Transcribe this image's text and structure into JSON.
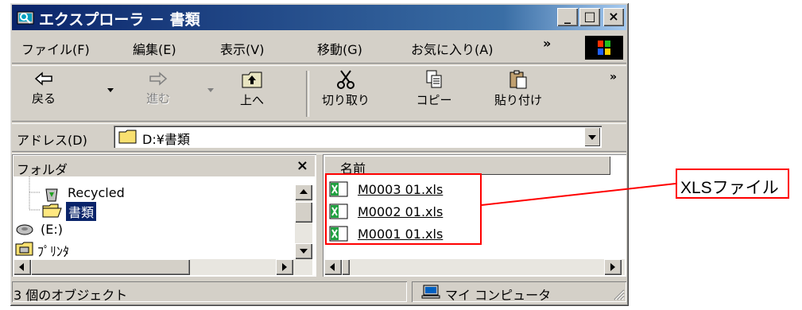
{
  "window": {
    "title": "エクスプローラ － 書類",
    "controls": [
      "_",
      "□",
      "×"
    ]
  },
  "menu": {
    "items": [
      "ファイル(F)",
      "編集(E)",
      "表示(V)",
      "移動(G)",
      "お気に入り(A)"
    ],
    "overflow": "»"
  },
  "toolbar": {
    "back": "戻る",
    "forward": "進む",
    "up": "上へ",
    "cut": "切り取り",
    "copy": "コピー",
    "paste": "貼り付け",
    "overflow": "»"
  },
  "address": {
    "label": "アドレス(D)",
    "value": "D:¥書類"
  },
  "folders": {
    "header": "フォルダ",
    "close": "×",
    "items": [
      {
        "label": "Recycled",
        "icon": "recycle-bin-icon"
      },
      {
        "label": "書類",
        "icon": "folder-open-icon",
        "selected": true
      },
      {
        "label": "(E:)",
        "icon": "drive-icon"
      },
      {
        "label": "ﾌﾟﾘﾝﾀ",
        "icon": "printer-folder-icon"
      }
    ]
  },
  "files": {
    "column": "名前",
    "items": [
      "M0003 01.xls",
      "M0002 01.xls",
      "M0001 01.xls"
    ]
  },
  "status": {
    "count": "3 個のオブジェクト",
    "location": "マイ コンピュータ"
  },
  "annotation": {
    "label": "XLSファイル",
    "color": "#ff0000"
  }
}
